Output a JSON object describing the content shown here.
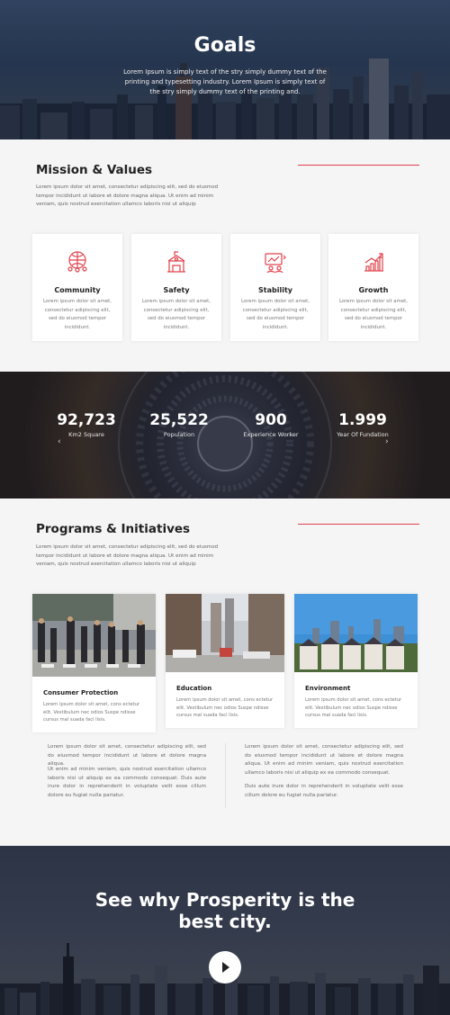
{
  "hero": {
    "title": "Goals",
    "text": "Lorem Ipsum is simply text of the stry simply dummy text of the printing and typesetting industry. Lorem Ipsum is simply text of the stry simply dummy text of the printing and."
  },
  "mission": {
    "title": "Mission & Values",
    "text": "Lorem ipsum dolor sit amet, consectetur adipiscing elit, sed do eiusmod tempor incididunt ut labore et dolore magna aliqua. Ut enim ad minim veniam, quis nostrud exercitation ullamco laboris nisi ut aliquip",
    "accent_color": "#e0414b",
    "cards": [
      {
        "title": "Community",
        "icon": "community-icon",
        "text": "Lorem ipsum dolor sit amet, consectetur adipiscing elit, sed do eiusmod tempor incididunt."
      },
      {
        "title": "Safety",
        "icon": "safety-icon",
        "text": "Lorem ipsum dolor sit amet, consectetur adipiscing elit, sed do eiusmod tempor incididunt."
      },
      {
        "title": "Stability",
        "icon": "stability-icon",
        "text": "Lorem ipsum dolor sit amet, consectetur adipiscing elit, sed do eiusmod tempor incididunt."
      },
      {
        "title": "Growth",
        "icon": "growth-icon",
        "text": "Lorem ipsum dolor sit amet, consectetur adipiscing elit, sed do eiusmod tempor incididunt."
      }
    ]
  },
  "stats": [
    {
      "value": "92,723",
      "label": "Km2 Square"
    },
    {
      "value": "25,522",
      "label": "Population"
    },
    {
      "value": "900",
      "label": "Experience Worker"
    },
    {
      "value": "1.999",
      "label": "Year Of Fundation"
    }
  ],
  "programs": {
    "title": "Programs & Initiatives",
    "text": "Lorem ipsum dolor sit amet, consectetur adipiscing elit, sed do eiusmod tempor incididunt ut labore et dolore magna aliqua. Ut enim ad minim veniam, quis nostrud exercitation ullamco laboris nisi ut aliquip",
    "cards": [
      {
        "title": "Consumer Protection",
        "text": "Lorem ipsum dolor sit amet, cons ectetur elit. Vestibulum nec odios Suspe ndisse cursus mal suada faci lisis."
      },
      {
        "title": "Education",
        "text": "Lorem ipsum dolor sit amet, cons ectetur elit. Vestibulum nec odios Suspe ndisse cursus mal suada faci lisis."
      },
      {
        "title": "Environment",
        "text": "Lorem ipsum dolor sit amet, cons ectetur elit. Vestibulum nec odios Suspe ndisse cursus mal suada faci lisis."
      }
    ],
    "col_left": {
      "p1": "Lorem ipsum dolor sit amet, consectetur adipiscing elit, sed do eiusmod tempor incididunt ut labore et dolore magna aliqua.",
      "p2": "Ut enim ad minim veniam, quis nostrud exercitation ullamco laboris nisi ut aliquip ex ea commodo consequat. Duis aute irure dolor in reprehenderit in voluptate velit esse cillum dolore eu fugiat nulla pariatur."
    },
    "col_right": {
      "p1": "Lorem ipsum dolor sit amet, consectetur adipiscing elit, sed do eiusmod tempor incididunt ut labore et dolore magna aliqua. Ut enim ad minim veniam, quis nostrud exercitation ullamco laboris nisi ut aliquip ex ea commodo consequat.",
      "p2": "Duis aute irure dolor in reprehenderit in voluptate velit esse cillum dolore eu fugiat nulla pariatur."
    }
  },
  "cta": {
    "title": "See why Prosperity is the best city.",
    "play_icon": "play-icon"
  }
}
